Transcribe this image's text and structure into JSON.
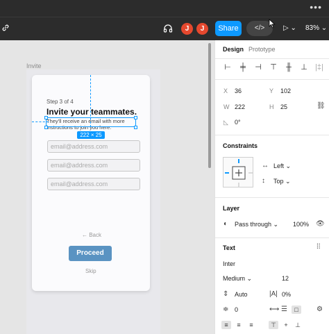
{
  "titlebar": {
    "more": "•••"
  },
  "toolbar": {
    "avatars": [
      "J",
      "J"
    ],
    "share_label": "Share",
    "code_label": "</>",
    "play_label": "▷ ⌄",
    "zoom": "83%"
  },
  "canvas": {
    "frame_label": "Invite",
    "step": "Step 3 of 4",
    "title": "Invite your teammates.",
    "subtitle": "They'll receive an email with more instructions to join you here.",
    "selection_size": "222 × 25",
    "email_placeholders": [
      "email@address.com",
      "email@address.com",
      "email@address.com"
    ],
    "back_label": "← Back",
    "proceed_label": "Proceed",
    "skip_label": "Skip"
  },
  "panel": {
    "tabs": [
      "Design",
      "Prototype"
    ],
    "x_label": "X",
    "x": "36",
    "y_label": "Y",
    "y": "102",
    "w_label": "W",
    "w": "222",
    "h_label": "H",
    "h": "25",
    "rotation": "0°",
    "constraints_title": "Constraints",
    "horizontal": "Left",
    "vertical": "Top",
    "layer_title": "Layer",
    "blend": "Pass through",
    "opacity": "100%",
    "text_title": "Text",
    "font": "Inter",
    "weight": "Medium",
    "size": "12",
    "line_height": "Auto",
    "letter_spacing": "0%",
    "paragraph_spacing": "0"
  },
  "colors": {
    "accent": "#0d99ff",
    "avatar": "#e5482e",
    "proceed": "#5a93c2"
  }
}
